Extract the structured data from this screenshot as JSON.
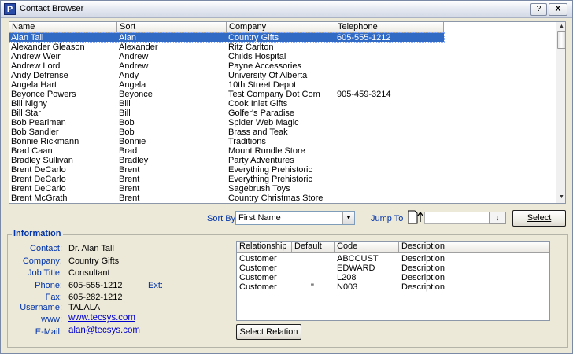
{
  "window": {
    "title": "Contact Browser",
    "app_icon_letter": "P",
    "help_label": "?",
    "close_label": "X"
  },
  "grid": {
    "columns": [
      "Name",
      "Sort",
      "Company",
      "Telephone"
    ],
    "rows": [
      {
        "name": "Alan Tall",
        "sort": "Alan",
        "company": "Country Gifts",
        "phone": "605-555-1212",
        "selected": true
      },
      {
        "name": "Alexander Gleason",
        "sort": "Alexander",
        "company": "Ritz Carlton",
        "phone": ""
      },
      {
        "name": "Andrew Weir",
        "sort": "Andrew",
        "company": "Childs Hospital",
        "phone": ""
      },
      {
        "name": "Andrew Lord",
        "sort": "Andrew",
        "company": "Payne Accessories",
        "phone": ""
      },
      {
        "name": "Andy Defrense",
        "sort": "Andy",
        "company": "University Of Alberta",
        "phone": ""
      },
      {
        "name": "Angela Hart",
        "sort": "Angela",
        "company": "10th Street Depot",
        "phone": ""
      },
      {
        "name": "Beyonce Powers",
        "sort": "Beyonce",
        "company": "Test Company Dot Com",
        "phone": "905-459-3214"
      },
      {
        "name": "Bill Nighy",
        "sort": "Bill",
        "company": "Cook Inlet Gifts",
        "phone": ""
      },
      {
        "name": "Bill Star",
        "sort": "Bill",
        "company": "Golfer's Paradise",
        "phone": ""
      },
      {
        "name": "Bob Pearlman",
        "sort": "Bob",
        "company": "Spider Web Magic",
        "phone": ""
      },
      {
        "name": "Bob Sandler",
        "sort": "Bob",
        "company": "Brass and Teak",
        "phone": ""
      },
      {
        "name": "Bonnie Rickmann",
        "sort": "Bonnie",
        "company": "Traditions",
        "phone": ""
      },
      {
        "name": "Brad Caan",
        "sort": "Brad",
        "company": "Mount Rundle Store",
        "phone": ""
      },
      {
        "name": "Bradley Sullivan",
        "sort": "Bradley",
        "company": "Party Adventures",
        "phone": ""
      },
      {
        "name": "Brent DeCarlo",
        "sort": "Brent",
        "company": "Everything Prehistoric",
        "phone": ""
      },
      {
        "name": "Brent DeCarlo",
        "sort": "Brent",
        "company": "Everything Prehistoric",
        "phone": ""
      },
      {
        "name": "Brent DeCarlo",
        "sort": "Brent",
        "company": "Sagebrush Toys",
        "phone": ""
      },
      {
        "name": "Brent McGrath",
        "sort": "Brent",
        "company": "Country Christmas Store",
        "phone": ""
      }
    ]
  },
  "controls": {
    "sort_by_label": "Sort By",
    "sort_by_value": "First Name",
    "jump_to_label": "Jump To",
    "jump_value": "",
    "select_label": "Select"
  },
  "info": {
    "legend": "Information",
    "fields": [
      {
        "label": "Contact:",
        "value": "Dr. Alan Tall"
      },
      {
        "label": "Company:",
        "value": "Country Gifts"
      },
      {
        "label": "Job Title:",
        "value": "Consultant"
      },
      {
        "label": "Phone:",
        "value": "605-555-1212"
      },
      {
        "label": "Fax:",
        "value": "605-282-1212"
      },
      {
        "label": "Username:",
        "value": "TALALA"
      },
      {
        "label": "www:",
        "value": "www.tecsys.com"
      },
      {
        "label": "E-Mail:",
        "value": "alan@tecsys.com"
      }
    ],
    "ext_label": "Ext:",
    "ext_value": ""
  },
  "relations": {
    "columns": [
      "Relationship",
      "Default",
      "Code",
      "Description"
    ],
    "rows": [
      {
        "relationship": "Customer",
        "default": "",
        "code": "ABCCUST",
        "description": "Description"
      },
      {
        "relationship": "Customer",
        "default": "",
        "code": "EDWARD",
        "description": "Description"
      },
      {
        "relationship": "Customer",
        "default": "",
        "code": "L208",
        "description": "Description"
      },
      {
        "relationship": "Customer",
        "default": "\"",
        "code": "N003",
        "description": "Description"
      }
    ],
    "button_label": "Select Relation"
  }
}
